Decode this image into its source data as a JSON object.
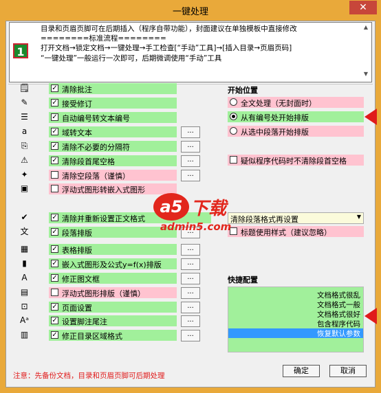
{
  "window": {
    "title": "一键处理",
    "close_label": "✕"
  },
  "info": {
    "logo": "1",
    "lines": [
      "目录和页眉页脚可在后期插入（程序自带功能），封面建议在单独模板中直接修改",
      "========标准流程========",
      "打开文档→锁定文档→一键处理→手工检查[“手动”工具]→[插入目录→页眉页码]",
      "“一键处理”一般运行一次即可，后期微调使用“手动”工具"
    ]
  },
  "options": [
    {
      "icon": "comment-icon",
      "glyph": "🗒",
      "label": "清除批注",
      "checked": true,
      "color": "green",
      "dots": false
    },
    {
      "icon": "track-changes-icon",
      "glyph": "✎",
      "label": "接受修订",
      "checked": true,
      "color": "green",
      "dots": false
    },
    {
      "icon": "numbered-list-icon",
      "glyph": "☰",
      "label": "自动编号转文本编号",
      "checked": true,
      "color": "green",
      "dots": false
    },
    {
      "icon": "field-text-icon",
      "glyph": "a",
      "label": "域转文本",
      "checked": true,
      "color": "green",
      "dots": true
    },
    {
      "icon": "separator-icon",
      "glyph": "⎘",
      "label": "清除不必要的分隔符",
      "checked": true,
      "color": "green",
      "dots": true
    },
    {
      "icon": "warning-icon",
      "glyph": "⚠",
      "label": "清除段首尾空格",
      "checked": true,
      "color": "green",
      "dots": true
    },
    {
      "icon": "empty-paragraph-icon",
      "glyph": "✦",
      "label": "清除空段落（谨慎）",
      "checked": false,
      "color": "pink",
      "dots": true
    },
    {
      "icon": "floating-image-icon",
      "glyph": "▣",
      "label": "浮动式图形转嵌入式图形",
      "checked": false,
      "color": "pink",
      "dots": false
    },
    {
      "icon": "reset-format-icon",
      "glyph": "✔",
      "label": "清除并重新设置正文格式",
      "checked": true,
      "color": "green",
      "dots": false,
      "wide": true
    },
    {
      "icon": "paragraph-layout-icon",
      "glyph": "文",
      "label": "段落排版",
      "checked": true,
      "color": "green",
      "dots": true
    },
    {
      "icon": "table-icon",
      "glyph": "▦",
      "label": "表格排版",
      "checked": true,
      "color": "green",
      "dots": true
    },
    {
      "icon": "chart-icon",
      "glyph": "▮",
      "label": "嵌入式图形及公式y=f(x)排版",
      "checked": true,
      "color": "green",
      "dots": true
    },
    {
      "icon": "text-box-icon",
      "glyph": "A",
      "label": "修正图文框",
      "checked": true,
      "color": "green",
      "dots": true
    },
    {
      "icon": "float-layout-icon",
      "glyph": "▤",
      "label": "浮动式图形排版（谨慎）",
      "checked": false,
      "color": "pink",
      "dots": true
    },
    {
      "icon": "page-setup-icon",
      "glyph": "⊡",
      "label": "页面设置",
      "checked": true,
      "color": "green",
      "dots": true
    },
    {
      "icon": "footnote-icon",
      "glyph": "Aᵃ",
      "label": "设置脚注尾注",
      "checked": true,
      "color": "green",
      "dots": true
    },
    {
      "icon": "toc-icon",
      "glyph": "▥",
      "label": "修正目录区域格式",
      "checked": true,
      "color": "green",
      "dots": true
    }
  ],
  "start": {
    "title": "开始位置",
    "radios": [
      {
        "label": "全文处理（无封面时）",
        "selected": false,
        "color": "pink"
      },
      {
        "label": "从有编号处开始排版",
        "selected": true,
        "color": "green"
      },
      {
        "label": "从选中段落开始排版",
        "selected": false,
        "color": "pink"
      }
    ],
    "code_option": {
      "label": "疑似程序代码时不清除段首空格",
      "checked": false
    }
  },
  "format": {
    "combo_value": "清除段落格式再设置",
    "heading_option": {
      "label": "标题使用样式（建议忽略）",
      "checked": false
    }
  },
  "quick": {
    "title": "快捷配置",
    "items": [
      "文档格式很乱",
      "文档格式一般",
      "文档格式很好",
      "包含程序代码",
      "恢复默认参数"
    ],
    "selected_index": 4
  },
  "footer": {
    "note": "注意：先备份文档，目录和页眉页脚可后期处理",
    "ok_label": "确定",
    "cancel_label": "取消"
  },
  "watermark": {
    "logo_text": "a5",
    "brand": "下载",
    "url": "admin5.com"
  }
}
